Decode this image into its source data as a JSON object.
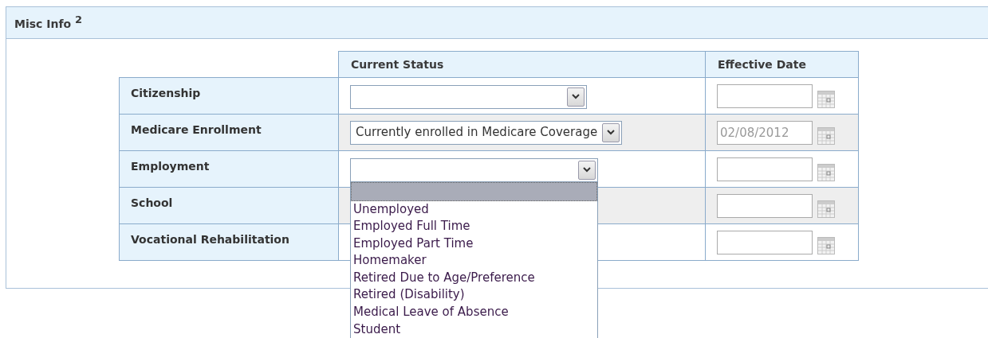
{
  "panel": {
    "title": "Misc Info $^{2}$"
  },
  "table": {
    "columns": [
      "Current Status",
      "Effective Date"
    ],
    "rows": [
      {
        "label": "Citizenship"
      },
      {
        "label": "Medicare Enrollment",
        "status": {
          "value": "Currently enrolled in Medicare Coverage"
        },
        "date": {
          "value": "02/08/2012",
          "disabled": true
        }
      },
      {
        "label": "Employment",
        "status": {
          "options": [
            {
              "selected": true
            },
            {
              "label": "Unemployed",
              "selected": false
            },
            {
              "label": "Employed Full Time",
              "selected": false
            },
            {
              "label": "Employed Part Time",
              "selected": false
            },
            {
              "label": "Homemaker",
              "selected": false
            },
            {
              "label": "Retired Due to Age/Preference",
              "selected": false
            },
            {
              "label": "Retired (Disability)",
              "selected": false
            },
            {
              "label": "Medical Leave of Absence",
              "selected": false
            },
            {
              "label": "Student",
              "selected": false
            }
          ]
        }
      },
      {
        "label": "School"
      },
      {
        "label": "Vocational Rehabilitation"
      }
    ]
  }
}
